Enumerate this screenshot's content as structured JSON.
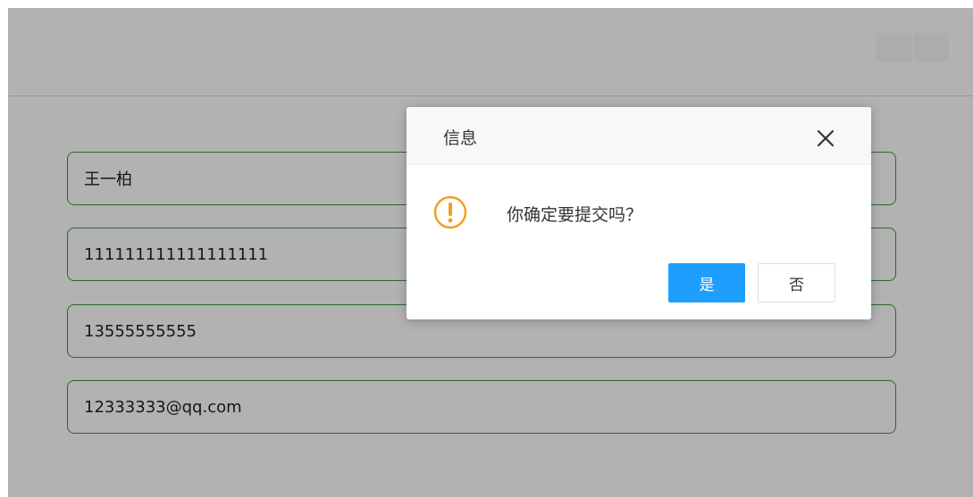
{
  "form": {
    "fields": [
      {
        "value": "王一柏"
      },
      {
        "value": "111111111111111111"
      },
      {
        "value": "13555555555"
      },
      {
        "value": "12333333@qq.com"
      }
    ]
  },
  "dialog": {
    "title": "信息",
    "message": "你确定要提交吗？",
    "confirm_label": "是",
    "cancel_label": "否",
    "icon": "warning-exclamation-icon",
    "close_icon": "close-icon"
  },
  "colors": {
    "field_border": "#3a9a3a",
    "primary_button": "#1e9fff",
    "warning_icon": "#f0a020",
    "overlay": "rgba(0,0,0,0.30)"
  }
}
